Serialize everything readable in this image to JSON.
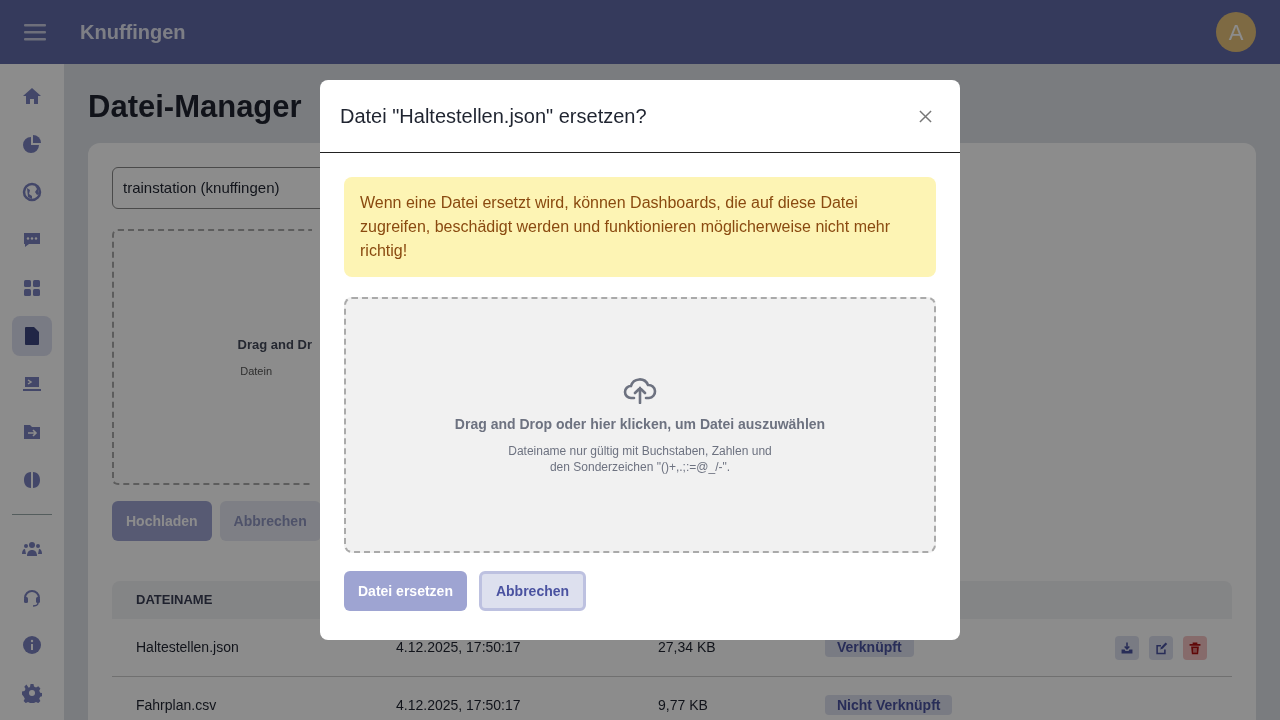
{
  "app_bar": {
    "title": "Knuffingen",
    "avatar": "A"
  },
  "sidebar": {
    "items": [
      {
        "kind": "home",
        "selected": false
      },
      {
        "kind": "pie",
        "selected": false
      },
      {
        "kind": "globe",
        "selected": false
      },
      {
        "kind": "chat",
        "selected": false
      },
      {
        "kind": "grid",
        "selected": false
      },
      {
        "kind": "file",
        "selected": true
      },
      {
        "kind": "terminal",
        "selected": false
      },
      {
        "kind": "folder",
        "selected": false
      },
      {
        "kind": "brain",
        "selected": false
      }
    ],
    "bottom_items": [
      {
        "kind": "users",
        "selected": false
      },
      {
        "kind": "headset",
        "selected": false
      },
      {
        "kind": "info",
        "selected": false
      },
      {
        "kind": "gear",
        "selected": false
      }
    ]
  },
  "page": {
    "title": "Datei-Manager",
    "source_select": "trainstation (knuffingen)",
    "dropzone": {
      "title": "Drag and Dr",
      "hint": "Datein"
    },
    "buttons": [
      {
        "label": "Hochladen",
        "kind": "primary",
        "disabled": true
      },
      {
        "label": "Abbrechen",
        "kind": "secondary",
        "disabled": true
      }
    ],
    "table": {
      "columns": [
        "DATEINAME"
      ],
      "rows": [
        {
          "name": "Haltestellen.json",
          "date": "4.12.2025, 17:50:17",
          "size": "27,34 KB",
          "status": "Verknüpft",
          "actions": true
        },
        {
          "name": "Fahrplan.csv",
          "date": "4.12.2025, 17:50:17",
          "size": "9,77 KB",
          "status": "Nicht Verknüpft",
          "actions": false
        }
      ]
    }
  },
  "dialog": {
    "title": "Datei \"Haltestellen.json\" ersetzen?",
    "warning": "Wenn eine Datei ersetzt wird, können Dashboards, die auf diese Datei zugreifen, beschädigt werden und funktionieren möglicherweise nicht mehr richtig!",
    "dropzone": {
      "title": "Drag and Drop oder hier klicken, um Datei auszuwählen",
      "hint_lines": [
        "Dateiname nur gültig mit Buchstaben, Zahlen und",
        "den Sonderzeichen \"()+,.;:=@_/-\"."
      ]
    },
    "buttons": [
      {
        "label": "Datei ersetzen",
        "kind": "primary",
        "disabled": true
      },
      {
        "label": "Abbrechen",
        "kind": "secondary",
        "disabled": false
      }
    ]
  }
}
